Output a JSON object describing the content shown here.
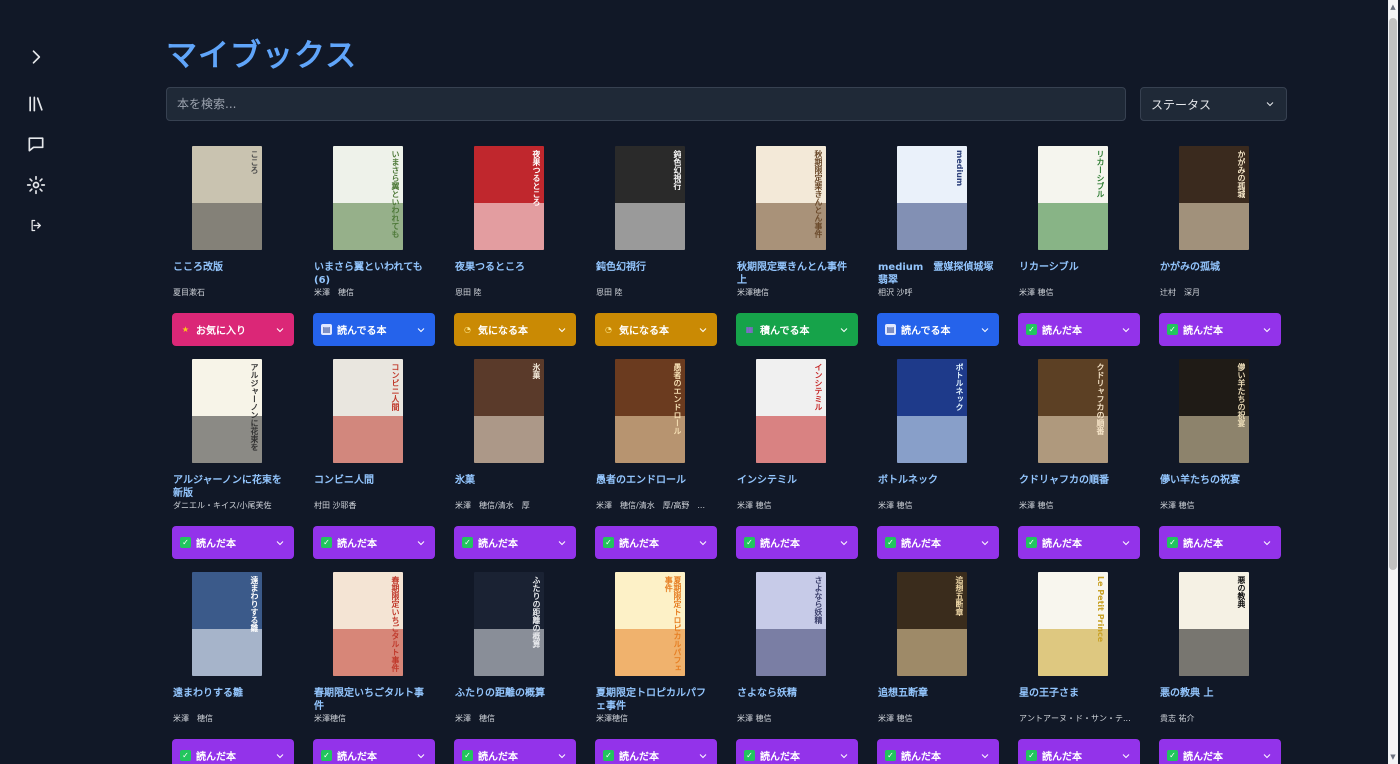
{
  "page": {
    "title": "マイブックス"
  },
  "search": {
    "placeholder": "本を検索..."
  },
  "status_filter": {
    "label": "ステータス"
  },
  "sidebar": {
    "items": [
      {
        "name": "expand-icon"
      },
      {
        "name": "library-icon"
      },
      {
        "name": "chat-icon"
      },
      {
        "name": "settings-icon"
      },
      {
        "name": "logout-icon"
      }
    ]
  },
  "status_styles": {
    "お気に入り": {
      "bg": "#db2777",
      "icon": "★",
      "icon_color": "#facc15",
      "icon_bg": "transparent"
    },
    "読んでる本": {
      "bg": "#2563eb",
      "icon": "▤",
      "icon_color": "#1e3a8a",
      "icon_bg": "#e0e7ff"
    },
    "気になる本": {
      "bg": "#ca8a04",
      "icon": "◔",
      "icon_color": "#fde68a",
      "icon_bg": "transparent"
    },
    "積んでる本": {
      "bg": "#16a34a",
      "icon": "▦",
      "icon_color": "#a855f7",
      "icon_bg": "transparent"
    },
    "読んだ本": {
      "bg": "#9333ea",
      "icon": "✓",
      "icon_color": "#ffffff",
      "icon_bg": "#22c55e"
    }
  },
  "books": [
    {
      "title": "こころ改版",
      "author": "夏目漱石",
      "status": "お気に入り",
      "cover": {
        "bg": "#c9c3b0",
        "accent": "#4b4b4b",
        "text": "こころ"
      }
    },
    {
      "title": "いまさら翼といわれても (6)",
      "author": "米澤　穂信",
      "status": "読んでる本",
      "cover": {
        "bg": "#eef2ea",
        "accent": "#4f7a3a",
        "text": "いまさら翼といわれても"
      }
    },
    {
      "title": "夜果つるところ",
      "author": "恩田 陸",
      "status": "気になる本",
      "cover": {
        "bg": "#c0272d",
        "accent": "#ffffff",
        "text": "夜果つるところ"
      }
    },
    {
      "title": "鈍色幻視行",
      "author": "恩田 陸",
      "status": "気になる本",
      "cover": {
        "bg": "#2a2a2a",
        "accent": "#f5f5f5",
        "text": "鈍色幻視行"
      }
    },
    {
      "title": "秋期限定栗きんとん事件 上",
      "author": "米澤穂信",
      "status": "積んでる本",
      "cover": {
        "bg": "#f3e9d8",
        "accent": "#6b4a2b",
        "text": "秋期限定栗きんとん事件"
      }
    },
    {
      "title": "medium　霊媒探偵城塚翡翠",
      "author": "相沢 沙呼",
      "status": "読んでる本",
      "cover": {
        "bg": "#eaf1fa",
        "accent": "#2b3f7a",
        "text": "medium"
      }
    },
    {
      "title": "リカーシブル",
      "author": "米澤 穂信",
      "status": "読んだ本",
      "cover": {
        "bg": "#f5f5ee",
        "accent": "#2e7d32",
        "text": "リカーシブル"
      }
    },
    {
      "title": "かがみの孤城",
      "author": "辻村　深月",
      "status": "読んだ本",
      "cover": {
        "bg": "#3a2a1e",
        "accent": "#f5e6c8",
        "text": "かがみの孤城"
      }
    },
    {
      "title": "アルジャーノンに花束を新版",
      "author": "ダニエル・キイス/小尾芙佐",
      "status": "読んだ本",
      "cover": {
        "bg": "#f7f4e8",
        "accent": "#333333",
        "text": "アルジャーノンに花束を"
      }
    },
    {
      "title": "コンビニ人間",
      "author": "村田 沙耶香",
      "status": "読んだ本",
      "cover": {
        "bg": "#e9e6df",
        "accent": "#c0392b",
        "text": "コンビニ人間"
      }
    },
    {
      "title": "氷菓",
      "author": "米澤　穂信/清水　厚",
      "status": "読んだ本",
      "cover": {
        "bg": "#5a3a2a",
        "accent": "#f0e6d6",
        "text": "氷菓"
      }
    },
    {
      "title": "愚者のエンドロール",
      "author": "米澤　穂信/清水　厚/高野　...",
      "status": "読んだ本",
      "cover": {
        "bg": "#6b3b1f",
        "accent": "#f5deb3",
        "text": "愚者のエンドロール"
      }
    },
    {
      "title": "インシテミル",
      "author": "米澤 穂信",
      "status": "読んだ本",
      "cover": {
        "bg": "#f0f0f0",
        "accent": "#c62828",
        "text": "インシテミル"
      }
    },
    {
      "title": "ボトルネック",
      "author": "米澤 穂信",
      "status": "読んだ本",
      "cover": {
        "bg": "#1e3a8a",
        "accent": "#e0f2fe",
        "text": "ボトルネック"
      }
    },
    {
      "title": "クドリャフカの順番",
      "author": "米澤 穂信",
      "status": "読んだ本",
      "cover": {
        "bg": "#5c4024",
        "accent": "#f4e2c6",
        "text": "クドリャフカの順番"
      }
    },
    {
      "title": "儚い羊たちの祝宴",
      "author": "米澤 穂信",
      "status": "読んだ本",
      "cover": {
        "bg": "#1f1b16",
        "accent": "#e8d9b5",
        "text": "儚い羊たちの祝宴"
      }
    },
    {
      "title": "遠まわりする雛",
      "author": "米澤　穂信",
      "status": "読んだ本",
      "cover": {
        "bg": "#3b5a8a",
        "accent": "#ffffff",
        "text": "遠まわりする雛"
      }
    },
    {
      "title": "春期限定いちごタルト事件",
      "author": "米澤穂信",
      "status": "読んだ本",
      "cover": {
        "bg": "#f4e4d4",
        "accent": "#c0392b",
        "text": "春期限定いちごタルト事件"
      }
    },
    {
      "title": "ふたりの距離の概算",
      "author": "米澤　穂信",
      "status": "読んだ本",
      "cover": {
        "bg": "#1a2233",
        "accent": "#e5e7eb",
        "text": "ふたりの距離の概算"
      }
    },
    {
      "title": "夏期限定トロピカルパフェ事件",
      "author": "米澤穂信",
      "status": "読んだ本",
      "cover": {
        "bg": "#fdf1c7",
        "accent": "#e67e22",
        "text": "夏期限定トロピカルパフェ事件"
      }
    },
    {
      "title": "さよなら妖精",
      "author": "米澤 穂信",
      "status": "読んだ本",
      "cover": {
        "bg": "#c7cbe8",
        "accent": "#3b3f6b",
        "text": "さよなら妖精"
      }
    },
    {
      "title": "追想五断章",
      "author": "米澤 穂信",
      "status": "読んだ本",
      "cover": {
        "bg": "#3a2c1c",
        "accent": "#f0d9a8",
        "text": "追想五断章"
      }
    },
    {
      "title": "星の王子さま",
      "author": "アントアーヌ・ド・サン・テ...",
      "status": "読んだ本",
      "cover": {
        "bg": "#f8f6ee",
        "accent": "#c9a227",
        "text": "Le Petit Prince"
      }
    },
    {
      "title": "悪の教典 上",
      "author": "貴志 祐介",
      "status": "読んだ本",
      "cover": {
        "bg": "#f5f1e4",
        "accent": "#111111",
        "text": "悪の教典"
      }
    }
  ]
}
